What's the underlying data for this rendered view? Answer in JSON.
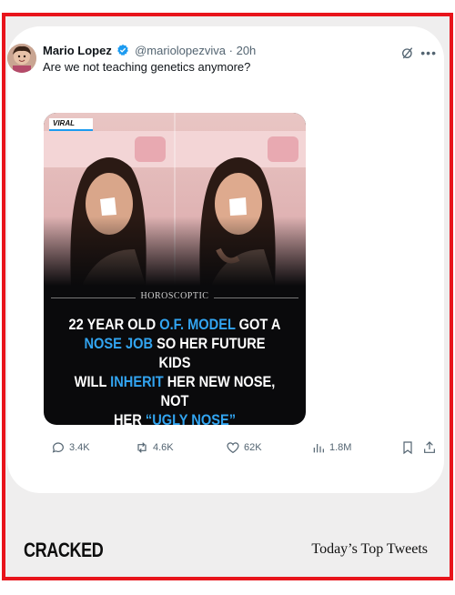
{
  "tweet": {
    "author_name": "Mario Lopez",
    "handle": "@mariolopezviva",
    "separator": "·",
    "time": "20h",
    "text": "Are we not teaching genetics anymore?",
    "more_icon": "more-icon",
    "media": {
      "tag": "VIRAL",
      "brand": "HOROSCOPTIC",
      "headline_lines": [
        {
          "parts": [
            {
              "t": "22 YEAR OLD ",
              "hl": false
            },
            {
              "t": "O.F. MODEL",
              "hl": true
            },
            {
              "t": " GOT A",
              "hl": false
            }
          ]
        },
        {
          "parts": [
            {
              "t": "NOSE JOB",
              "hl": true
            },
            {
              "t": " SO HER FUTURE KIDS",
              "hl": false
            }
          ]
        },
        {
          "parts": [
            {
              "t": "WILL ",
              "hl": false
            },
            {
              "t": "INHERIT",
              "hl": true
            },
            {
              "t": " HER NEW NOSE, NOT",
              "hl": false
            }
          ]
        },
        {
          "parts": [
            {
              "t": "HER ",
              "hl": false
            },
            {
              "t": "“UGLY NOSE”",
              "hl": true
            }
          ]
        }
      ]
    },
    "stats": {
      "replies": "3.4K",
      "reposts": "4.6K",
      "likes": "62K",
      "views": "1.8M"
    }
  },
  "footer": {
    "logo": "CRACKED",
    "title": "Today’s Top Tweets"
  },
  "colors": {
    "frame_border": "#e8141b",
    "accent_blue": "#1d9bf0",
    "headline_highlight": "#32a4f0",
    "muted": "#536471"
  }
}
